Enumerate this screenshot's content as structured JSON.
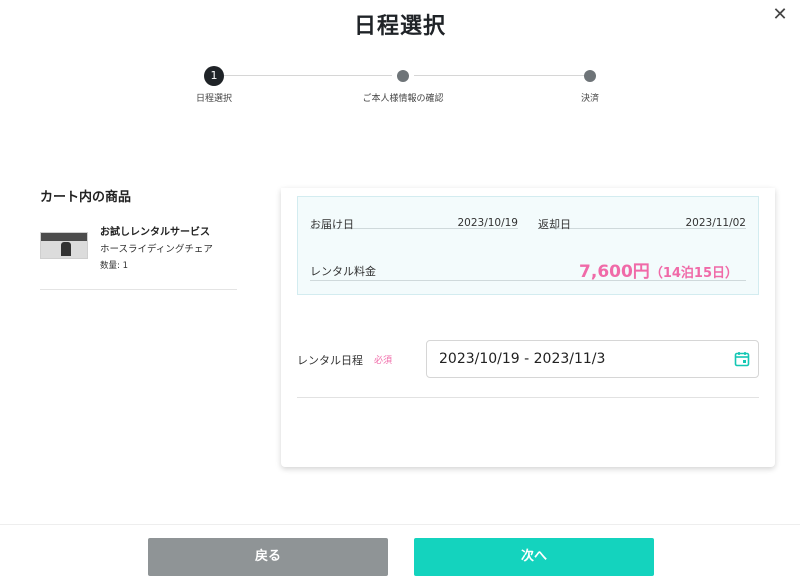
{
  "header": {
    "title": "日程選択",
    "close_icon": "close-icon"
  },
  "stepper": {
    "steps": [
      {
        "number": "1",
        "label": "日程選択",
        "active": true
      },
      {
        "number": "",
        "label": "ご本人様情報の確認",
        "active": false
      },
      {
        "number": "",
        "label": "決済",
        "active": false
      }
    ]
  },
  "cart": {
    "heading": "カート内の商品",
    "items": [
      {
        "name": "お試しレンタルサービス",
        "product": "ホースライディングチェア",
        "quantity": "数量: 1"
      }
    ]
  },
  "summary": {
    "delivery_label": "お届け日",
    "delivery_date": "2023/10/19",
    "return_label": "返却日",
    "return_date": "2023/11/02",
    "fee_label": "レンタル料金",
    "fee_amount": "7,600円",
    "fee_nights": "（14泊15日）"
  },
  "rental_period": {
    "label": "レンタル日程",
    "required": "必須",
    "value": "2023/10/19 - 2023/11/3",
    "icon": "calendar-icon"
  },
  "footer": {
    "back_label": "戻る",
    "next_label": "次へ"
  },
  "colors": {
    "accent": "#14d3be",
    "price": "#f06aa8",
    "back_button": "#8f9496",
    "active_step": "#1f2327"
  }
}
